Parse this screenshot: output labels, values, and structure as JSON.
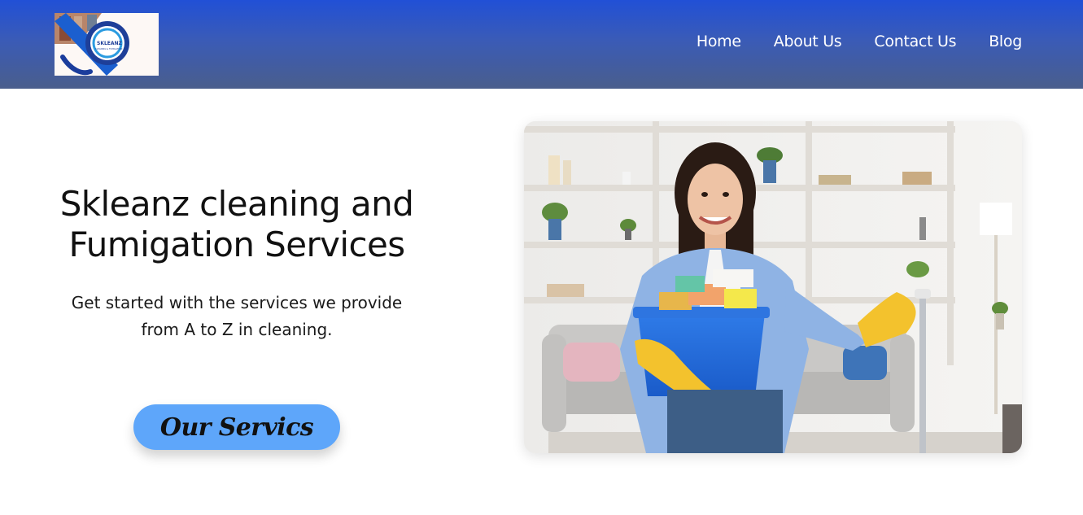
{
  "brand": {
    "logo_text": "SKLEANZ",
    "logo_tagline": "CLEANING & FUMIGATION"
  },
  "nav": {
    "items": [
      {
        "label": "Home"
      },
      {
        "label": "About Us"
      },
      {
        "label": "Contact Us"
      },
      {
        "label": "Blog"
      }
    ]
  },
  "hero": {
    "title_line1": "Skleanz cleaning and",
    "title_line2": "Fumigation Services",
    "subtitle_line1": "Get started with the services we provide",
    "subtitle_line2": "from A to Z in cleaning.",
    "cta_label": "Our Servics"
  },
  "colors": {
    "header_top": "#2150d6",
    "header_bottom": "#4a5e8c",
    "cta_background": "#5ea6fa",
    "accent_blue": "#1d6fd8"
  },
  "icons": {
    "logo": "brand-logo",
    "hero": "cleaning-woman-photo"
  }
}
